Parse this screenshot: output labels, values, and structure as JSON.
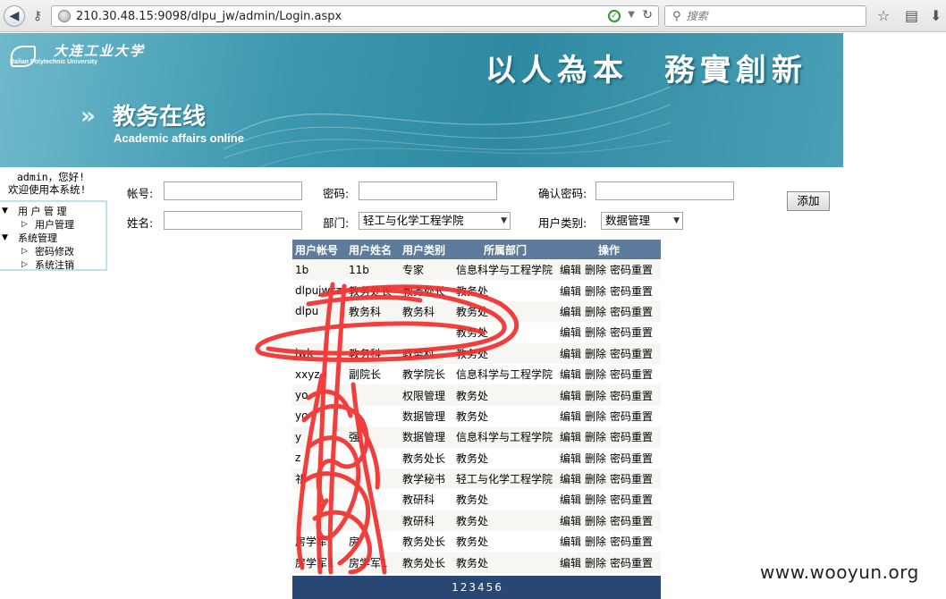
{
  "browser": {
    "url": "210.30.48.15:9098/dlpu_jw/admin/Login.aspx",
    "search_placeholder": "搜索"
  },
  "banner": {
    "logo_cn": "大连工业大学",
    "logo_en": "Dalian Polytechnic University",
    "motto": "以人為本　務實創新",
    "system_cn": "教务在线",
    "system_en": "Academic affairs online"
  },
  "sidebar": {
    "greeting": "admin，您好!",
    "welcome": "欢迎使用本系统!",
    "tree": [
      {
        "label": "用 户 管 理",
        "level": 0,
        "expanded": true
      },
      {
        "label": "用户管理",
        "level": 1
      },
      {
        "label": "系统管理",
        "level": 0,
        "expanded": true
      },
      {
        "label": "密码修改",
        "level": 1
      },
      {
        "label": "系统注销",
        "level": 1
      }
    ]
  },
  "form": {
    "account_label": "帐号:",
    "account_value": "",
    "password_label": "密码:",
    "password_value": "",
    "confirm_label": "确认密码:",
    "confirm_value": "",
    "name_label": "姓名:",
    "name_value": "",
    "dept_label": "部门:",
    "dept_value": "轻工与化学工程学院",
    "type_label": "用户类别:",
    "type_value": "数据管理",
    "add_label": "添加"
  },
  "table": {
    "headers": [
      "用户帐号",
      "用户姓名",
      "用户类别",
      "所属部门",
      "操作"
    ],
    "ops": {
      "edit": "编辑",
      "delete": "删除",
      "reset": "密码重置"
    },
    "rows": [
      [
        "1b",
        "11b",
        "专家",
        "信息科学与工程学院"
      ],
      [
        "dlpujwcz",
        "教务处长",
        "教务处长",
        "教务处"
      ],
      [
        "dlpu",
        "教务科",
        "教务科",
        "教务处"
      ],
      [
        "",
        "",
        "",
        "教务处"
      ],
      [
        "jwk",
        "教务科",
        "教务科",
        "教务处"
      ],
      [
        "xxyz",
        "副院长",
        "教学院长",
        "信息科学与工程学院"
      ],
      [
        "yo",
        "",
        "权限管理",
        "教务处"
      ],
      [
        "yo",
        "",
        "数据管理",
        "教务处"
      ],
      [
        "y",
        "强",
        "数据管理",
        "信息科学与工程学院"
      ],
      [
        "z",
        "",
        "教务处长",
        "教务处"
      ],
      [
        "祁",
        "",
        "教学秘书",
        "轻工与化学工程学院"
      ],
      [
        "",
        "",
        "教研科",
        "教务处"
      ],
      [
        "",
        "",
        "教研科",
        "教务处"
      ],
      [
        "房学军",
        "房",
        "教务处长",
        "教务处"
      ],
      [
        "房学军1",
        "房学军1",
        "教务处长",
        "教务处"
      ]
    ],
    "pages": [
      "1",
      "2",
      "3",
      "4",
      "5",
      "6"
    ]
  },
  "watermark": "www.wooyun.org"
}
